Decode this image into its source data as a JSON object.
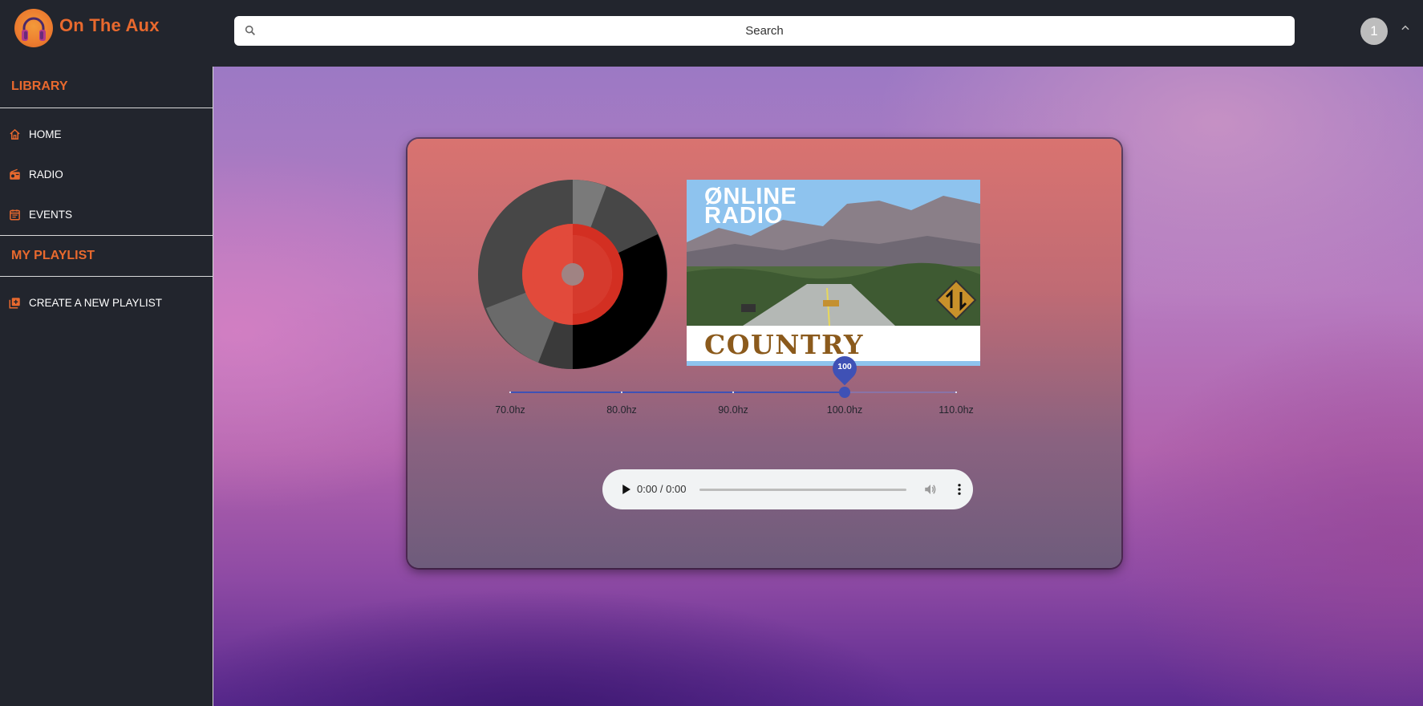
{
  "app": {
    "brand": "On The Aux"
  },
  "search": {
    "placeholder": "Search"
  },
  "user": {
    "avatar_initial": "1"
  },
  "sidebar": {
    "library_heading": "LIBRARY",
    "nav_items": [
      {
        "label": "HOME",
        "icon": "home-icon"
      },
      {
        "label": "RADIO",
        "icon": "radio-icon"
      },
      {
        "label": "EVENTS",
        "icon": "calendar-icon"
      }
    ],
    "playlist_heading": "MY PLAYLIST",
    "playlist_items": [
      {
        "label": "CREATE A NEW PLAYLIST",
        "icon": "playlist-add-icon"
      }
    ]
  },
  "player": {
    "station_art": {
      "line1": "ØNLINE",
      "line2": "RADIO",
      "genre": "COUNTRY"
    },
    "frequency": {
      "value": 100,
      "value_label": "100",
      "min": 70,
      "max": 110,
      "marks": [
        "70.0hz",
        "80.0hz",
        "90.0hz",
        "100.0hz",
        "110.0hz"
      ]
    },
    "audio": {
      "time": "0:00 / 0:00",
      "progress": 0
    }
  },
  "colors": {
    "accent_orange": "#e8692e",
    "sidebar_bg": "#22252d",
    "slider_blue": "#3f51b5"
  }
}
